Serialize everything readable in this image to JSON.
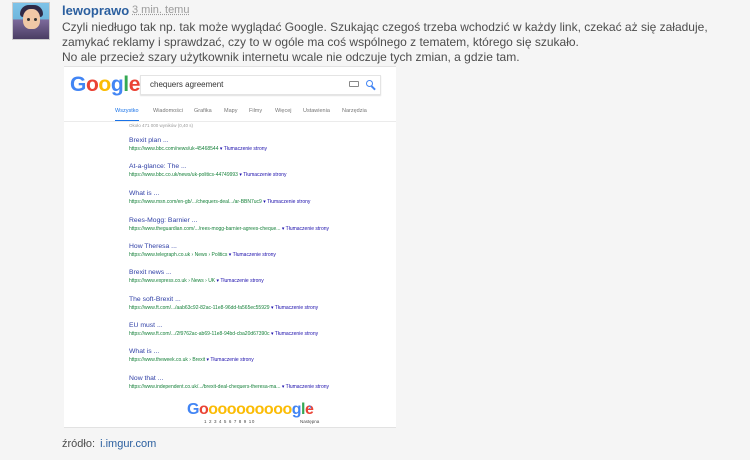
{
  "comment": {
    "author": "lewoprawo",
    "time": "3 min. temu",
    "paragraph1": "Czyli niedługo tak np. tak może wyglądać Google. Szukając czegoś trzeba wchodzić w każdy link, czekać aż się załaduje, zamykać reklamy i sprawdzać, czy to w ogóle ma coś wspólnego z tematem, którego się szukało.",
    "paragraph2": "No ale przecież szary użytkownik internetu wcale nie odczuje tych zmian, a gdzie tam.",
    "source_label": "źródło:",
    "source_link": "i.imgur.com"
  },
  "google": {
    "logo_letters": [
      "G",
      "o",
      "o",
      "g",
      "l",
      "e"
    ],
    "query": "chequers agreement",
    "tabs": [
      "Wszystko",
      "Wiadomości",
      "Grafika",
      "Mapy",
      "Filmy",
      "Więcej",
      "Ustawienia",
      "Narzędzia"
    ],
    "stats": "Około 471 000 wyników (0,40 s)",
    "results": [
      {
        "title": "Brexit plan ...",
        "url": "https://www.bbc.com/news/uk-45468544",
        "translate": "▾ Tłumaczenie strony"
      },
      {
        "title": "At-a-glance: The ...",
        "url": "https://www.bbc.co.uk/news/uk-politics-44749993",
        "translate": "▾ Tłumaczenie strony"
      },
      {
        "title": "What is ...",
        "url": "https://www.msn.com/en-gb/.../chequers-deal.../ar-BBN7uc9",
        "translate": "▾ Tłumaczenie strony"
      },
      {
        "title": "Rees-Mogg: Barnier ...",
        "url": "https://www.theguardian.com/.../rees-mogg-barnier-agrees-cheque...",
        "translate": "▾ Tłumaczenie strony"
      },
      {
        "title": "How Theresa ...",
        "url": "https://www.telegraph.co.uk › News › Politics",
        "translate": "▾ Tłumaczenie strony"
      },
      {
        "title": "Brexit news ...",
        "url": "https://www.express.co.uk › News › UK",
        "translate": "▾ Tłumaczenie strony"
      },
      {
        "title": "The soft-Brexit ...",
        "url": "https://www.ft.com/.../aab63c92-82ac-11e8-96dd-fa565ec55929",
        "translate": "▾ Tłumaczenie strony"
      },
      {
        "title": "EU must ...",
        "url": "https://www.ft.com/.../2f9762ac-ab69-11e8-94bd-cba20d67390c",
        "translate": "▾ Tłumaczenie strony"
      },
      {
        "title": "What is ...",
        "url": "https://www.theweek.co.uk › Brexit",
        "translate": "▾ Tłumaczenie strony"
      },
      {
        "title": "Now that ...",
        "url": "https://www.independent.co.uk/.../brexit-deal-chequers-theresa-ma...",
        "translate": "▾ Tłumaczenie strony"
      }
    ],
    "pager_letters": [
      "G",
      "o",
      "o",
      "o",
      "o",
      "o",
      "o",
      "o",
      "o",
      "o",
      "o",
      "g",
      "l",
      "e"
    ],
    "pager_pages": [
      "1",
      "2",
      "3",
      "4",
      "5",
      "6",
      "7",
      "8",
      "9",
      "10"
    ],
    "pager_next_label": "Następna",
    "colors": {
      "blue": "#4285f4",
      "red": "#ea4335",
      "yellow": "#fbbc05",
      "green": "#34a853",
      "link_blue": "#2f3fa6",
      "url_green": "#16813a"
    }
  }
}
